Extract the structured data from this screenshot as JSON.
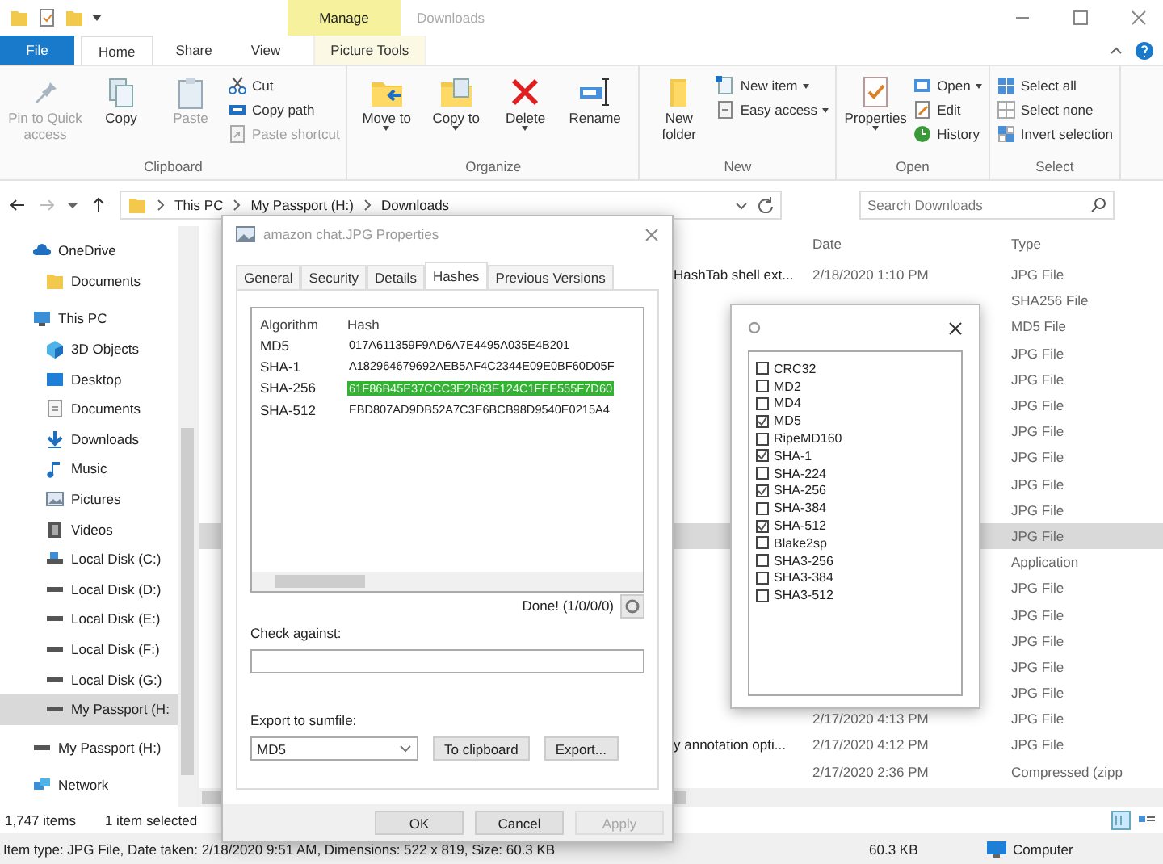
{
  "title_bar": {
    "context_tab": "Manage",
    "title": "Downloads"
  },
  "ribbon_tabs": [
    {
      "label": "File",
      "kind": "file",
      "selected": false
    },
    {
      "label": "Home",
      "kind": "normal",
      "selected": true
    },
    {
      "label": "Share",
      "kind": "normal",
      "selected": false
    },
    {
      "label": "View",
      "kind": "normal",
      "selected": false
    },
    {
      "label": "Picture Tools",
      "kind": "context",
      "selected": false
    }
  ],
  "ribbon": {
    "groups": [
      {
        "label": "Clipboard",
        "commands": [
          {
            "label": "Pin to Quick access",
            "kind": "large",
            "disabled": true,
            "dropdown": false
          },
          {
            "label": "Copy",
            "kind": "large",
            "disabled": false,
            "dropdown": false
          },
          {
            "label": "Paste",
            "kind": "large",
            "disabled": true,
            "dropdown": false
          },
          {
            "label": "Cut",
            "kind": "small",
            "disabled": false,
            "dropdown": false
          },
          {
            "label": "Copy path",
            "kind": "small",
            "disabled": false,
            "dropdown": false
          },
          {
            "label": "Paste shortcut",
            "kind": "small",
            "disabled": true,
            "dropdown": false
          }
        ]
      },
      {
        "label": "Organize",
        "commands": [
          {
            "label": "Move to",
            "kind": "large",
            "disabled": false,
            "dropdown": true
          },
          {
            "label": "Copy to",
            "kind": "large",
            "disabled": false,
            "dropdown": true
          },
          {
            "label": "Delete",
            "kind": "large",
            "disabled": false,
            "dropdown": true
          },
          {
            "label": "Rename",
            "kind": "large",
            "disabled": false,
            "dropdown": false
          }
        ]
      },
      {
        "label": "New",
        "commands": [
          {
            "label": "New folder",
            "kind": "large",
            "disabled": false,
            "dropdown": false
          },
          {
            "label": "New item",
            "kind": "small",
            "disabled": false,
            "dropdown": true
          },
          {
            "label": "Easy access",
            "kind": "small",
            "disabled": false,
            "dropdown": true
          }
        ]
      },
      {
        "label": "Open",
        "commands": [
          {
            "label": "Properties",
            "kind": "large",
            "disabled": false,
            "dropdown": true
          },
          {
            "label": "Open",
            "kind": "small",
            "disabled": false,
            "dropdown": true
          },
          {
            "label": "Edit",
            "kind": "small",
            "disabled": false,
            "dropdown": false
          },
          {
            "label": "History",
            "kind": "small",
            "disabled": false,
            "dropdown": false
          }
        ]
      },
      {
        "label": "Select",
        "commands": [
          {
            "label": "Select all",
            "kind": "small",
            "disabled": false,
            "dropdown": false
          },
          {
            "label": "Select none",
            "kind": "small",
            "disabled": false,
            "dropdown": false
          },
          {
            "label": "Invert selection",
            "kind": "small",
            "disabled": false,
            "dropdown": false
          }
        ]
      }
    ]
  },
  "address_bar": {
    "path": [
      "This PC",
      "My Passport (H:)",
      "Downloads"
    ],
    "search": {
      "placeholder": "Search Downloads"
    }
  },
  "sidebar": {
    "items": [
      {
        "label": "OneDrive",
        "selected": false,
        "children": [
          {
            "label": "Documents",
            "selected": false
          }
        ]
      },
      {
        "label": "This PC",
        "selected": false,
        "children": [
          {
            "label": "3D Objects",
            "selected": false
          },
          {
            "label": "Desktop",
            "selected": false
          },
          {
            "label": "Documents",
            "selected": false
          },
          {
            "label": "Downloads",
            "selected": false
          },
          {
            "label": "Music",
            "selected": false
          },
          {
            "label": "Pictures",
            "selected": false
          },
          {
            "label": "Videos",
            "selected": false
          },
          {
            "label": "Local Disk (C:)",
            "selected": false
          },
          {
            "label": "Local Disk (D:)",
            "selected": false
          },
          {
            "label": "Local Disk (E:)",
            "selected": false
          },
          {
            "label": "Local Disk (F:)",
            "selected": false
          },
          {
            "label": "Local Disk (G:)",
            "selected": false
          },
          {
            "label": "My Passport (H:",
            "selected": true
          }
        ]
      },
      {
        "label": "My Passport (H:)",
        "selected": false
      },
      {
        "label": "Network",
        "selected": false
      }
    ]
  },
  "file_list": {
    "columns": [
      "Date",
      "Type"
    ],
    "rows": [
      {
        "name": "HashTab shell ext...",
        "date": "2/18/2020 1:10 PM",
        "type": "JPG File",
        "selected": false
      },
      {
        "type": "SHA256 File",
        "selected": false
      },
      {
        "type": "MD5 File",
        "selected": false
      },
      {
        "type": "JPG File",
        "selected": false
      },
      {
        "type": "JPG File",
        "selected": false
      },
      {
        "type": "JPG File",
        "selected": false
      },
      {
        "type": "JPG File",
        "selected": false
      },
      {
        "type": "JPG File",
        "selected": false
      },
      {
        "type": "JPG File",
        "selected": false
      },
      {
        "type": "JPG File",
        "selected": false
      },
      {
        "type": "JPG File",
        "selected": true
      },
      {
        "type": "Application",
        "selected": false
      },
      {
        "type": "JPG File",
        "selected": false
      },
      {
        "type": "JPG File",
        "selected": false
      },
      {
        "type": "JPG File",
        "selected": false
      },
      {
        "type": "JPG File",
        "selected": false
      },
      {
        "type": "JPG File",
        "selected": false
      },
      {
        "date": "2/17/2020 4:13 PM",
        "type": "JPG File",
        "selected": false
      },
      {
        "name": "y annotation opti...",
        "date": "2/17/2020 4:12 PM",
        "type": "JPG File",
        "selected": false
      },
      {
        "date": "2/17/2020 2:36 PM",
        "type": "Compressed (zipp",
        "selected": false
      }
    ]
  },
  "status_bar": {
    "item_count": "1,747 items",
    "selection": "1 item selected",
    "details": "Item type: JPG File, Date taken: 2/18/2020 9:51 AM, Dimensions: 522 x 819, Size: 60.3 KB",
    "size": "60.3 KB",
    "location": "Computer"
  },
  "properties_dialog": {
    "title": "amazon chat.JPG Properties",
    "tabs": [
      {
        "label": "General",
        "selected": false
      },
      {
        "label": "Security",
        "selected": false
      },
      {
        "label": "Details",
        "selected": false
      },
      {
        "label": "Hashes",
        "selected": true
      },
      {
        "label": "Previous Versions",
        "selected": false
      }
    ],
    "hashes": {
      "columns": [
        "Algorithm",
        "Hash"
      ],
      "rows": [
        {
          "algorithm": "MD5",
          "hash": "017A611359F9AD6A7E4495A035E4B201",
          "selected": false
        },
        {
          "algorithm": "SHA-1",
          "hash": "A182964679692AEB5AF4C2344E09E0BF60D05F",
          "selected": false
        },
        {
          "algorithm": "SHA-256",
          "hash": "61F86B45E37CCC3E2B63E124C1FEE555F7D60",
          "selected": true
        },
        {
          "algorithm": "SHA-512",
          "hash": "EBD807AD9DB52A7C3E6BCB98D9540E0215A4",
          "selected": false
        }
      ]
    },
    "status": "Done! (1/0/0/0)",
    "check_label": "Check against:",
    "export_label": "Export to sumfile:",
    "export_format": "MD5",
    "export_buttons": [
      "To clipboard",
      "Export..."
    ],
    "buttons": [
      {
        "label": "OK",
        "disabled": false
      },
      {
        "label": "Cancel",
        "disabled": false
      },
      {
        "label": "Apply",
        "disabled": true
      }
    ]
  },
  "hash_popup": {
    "algorithms": [
      {
        "label": "CRC32",
        "checked": false
      },
      {
        "label": "MD2",
        "checked": false
      },
      {
        "label": "MD4",
        "checked": false
      },
      {
        "label": "MD5",
        "checked": true
      },
      {
        "label": "RipeMD160",
        "checked": false
      },
      {
        "label": "SHA-1",
        "checked": true
      },
      {
        "label": "SHA-224",
        "checked": false
      },
      {
        "label": "SHA-256",
        "checked": true
      },
      {
        "label": "SHA-384",
        "checked": false
      },
      {
        "label": "SHA-512",
        "checked": true
      },
      {
        "label": "Blake2sp",
        "checked": false
      },
      {
        "label": "SHA3-256",
        "checked": false
      },
      {
        "label": "SHA3-384",
        "checked": false
      },
      {
        "label": "SHA3-512",
        "checked": false
      }
    ]
  }
}
